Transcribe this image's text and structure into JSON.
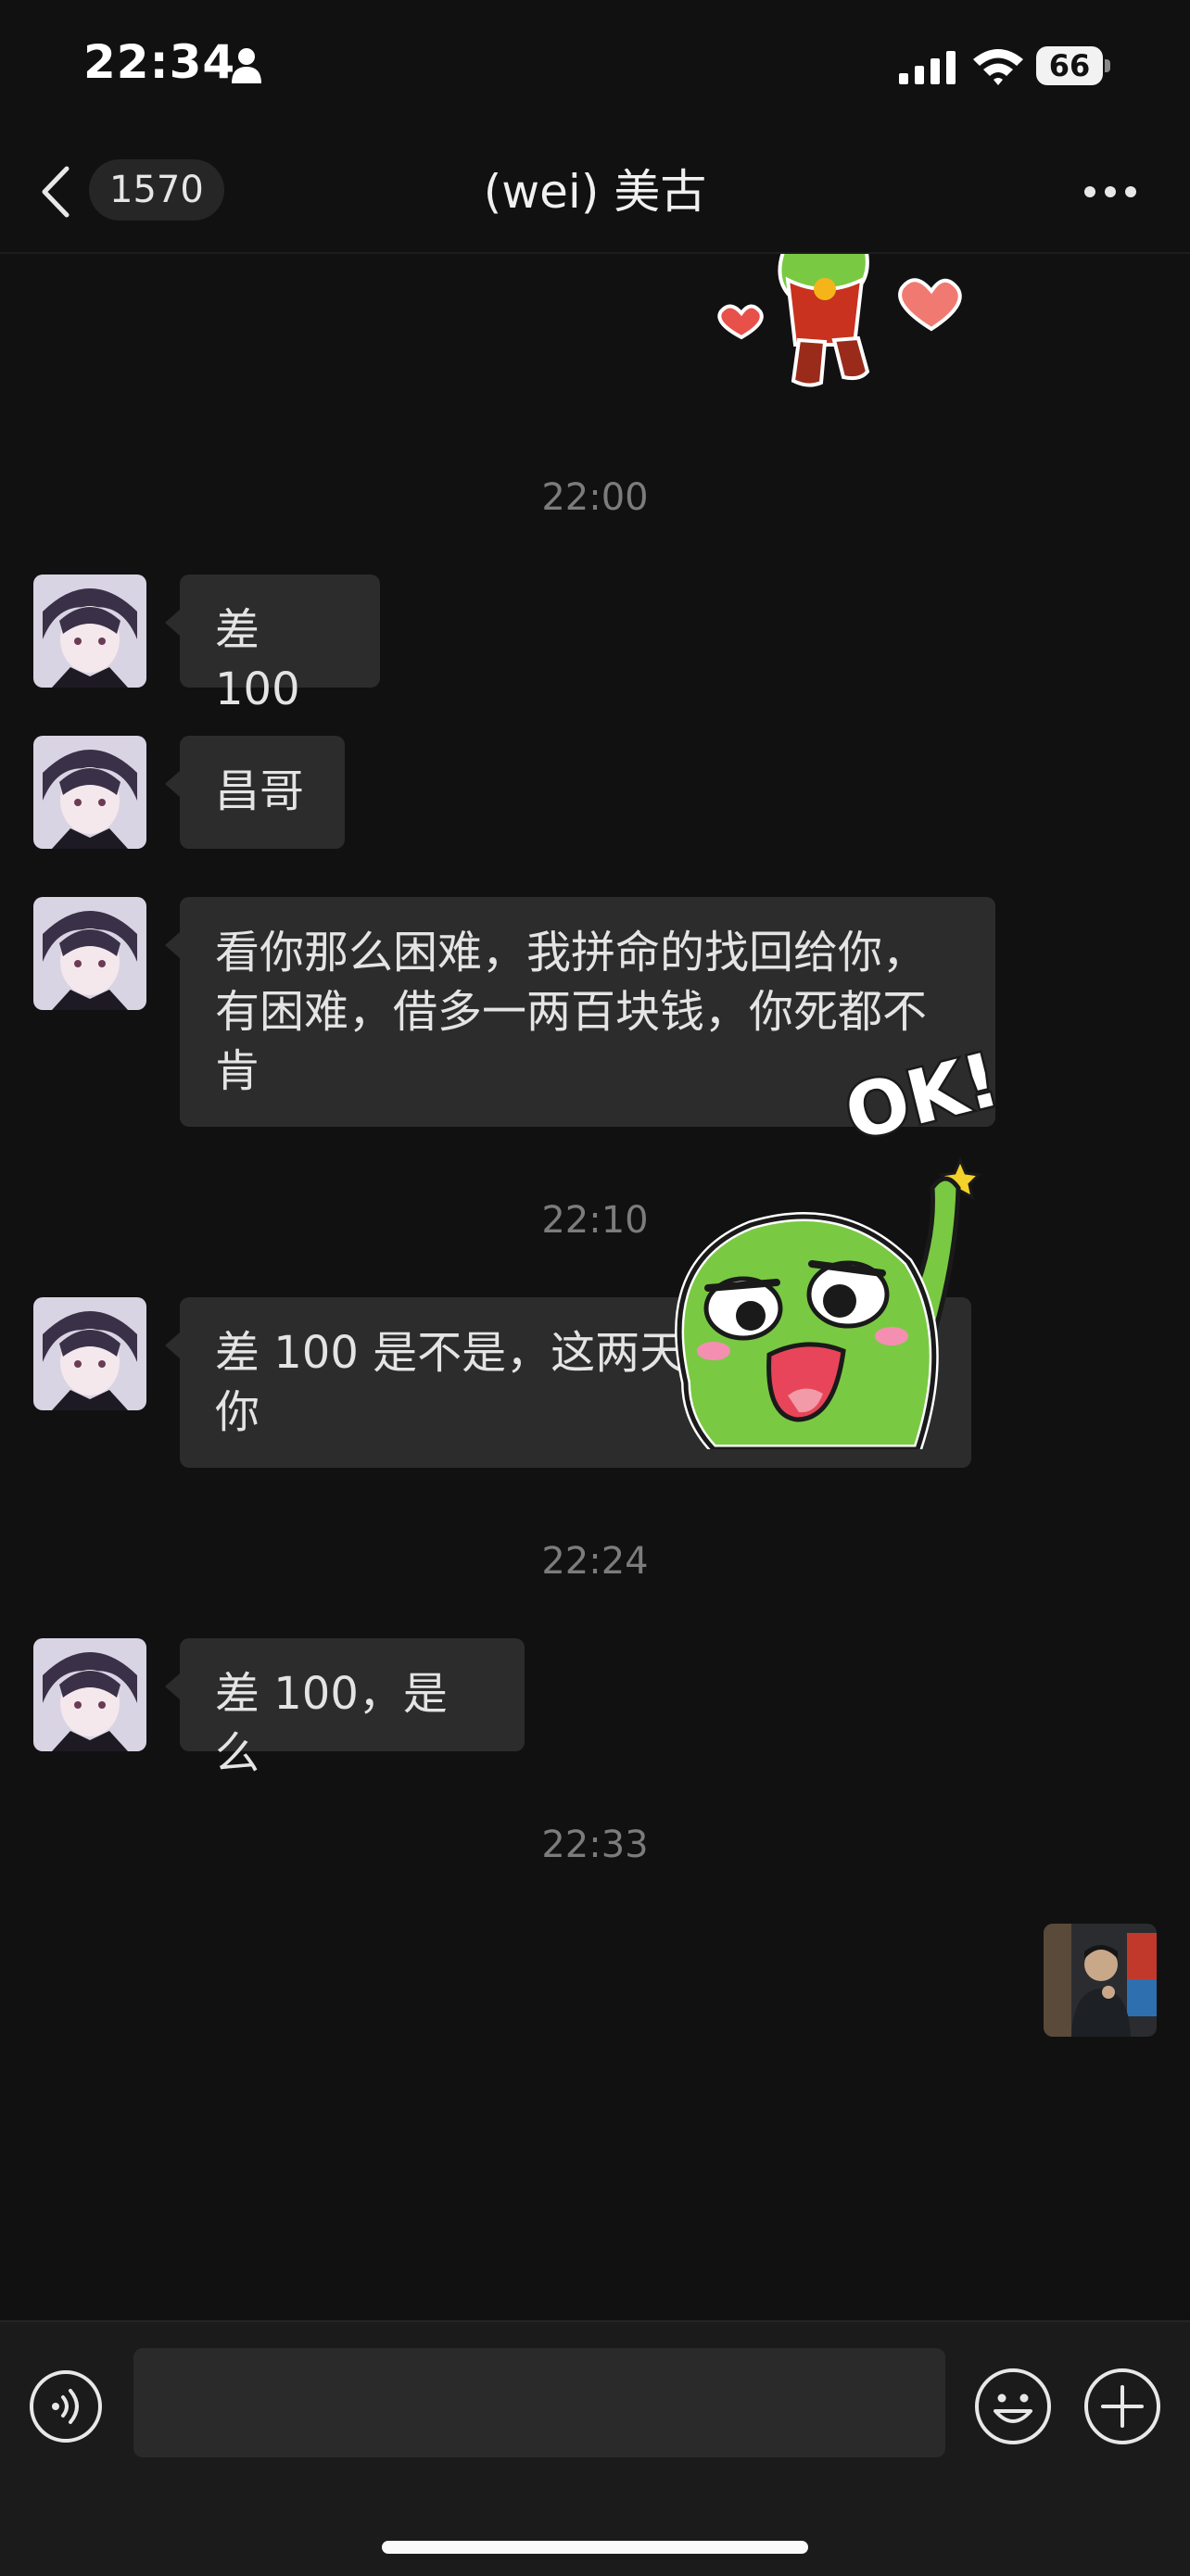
{
  "status_bar": {
    "time": "22:34",
    "battery": "66"
  },
  "header": {
    "unread_count": "1570",
    "title": "(wei)  美古"
  },
  "messages": [
    {
      "timestamp": "22:00"
    },
    {
      "text": "差 100"
    },
    {
      "text": "昌哥"
    },
    {
      "text": "看你那么困难，我拼命的找回给你，有困难，借多一两百块钱，你死都不肯"
    },
    {
      "timestamp": "22:10"
    },
    {
      "text": "差 100 是不是，这两天找到发回给你"
    },
    {
      "timestamp": "22:24"
    },
    {
      "text": "差 100，是么"
    },
    {
      "timestamp": "22:33"
    }
  ],
  "sticker_ok": {
    "text": "OK!"
  },
  "colors": {
    "background": "#111111",
    "bubble": "#2c2c2c",
    "sticker_green": "#7ac943"
  }
}
